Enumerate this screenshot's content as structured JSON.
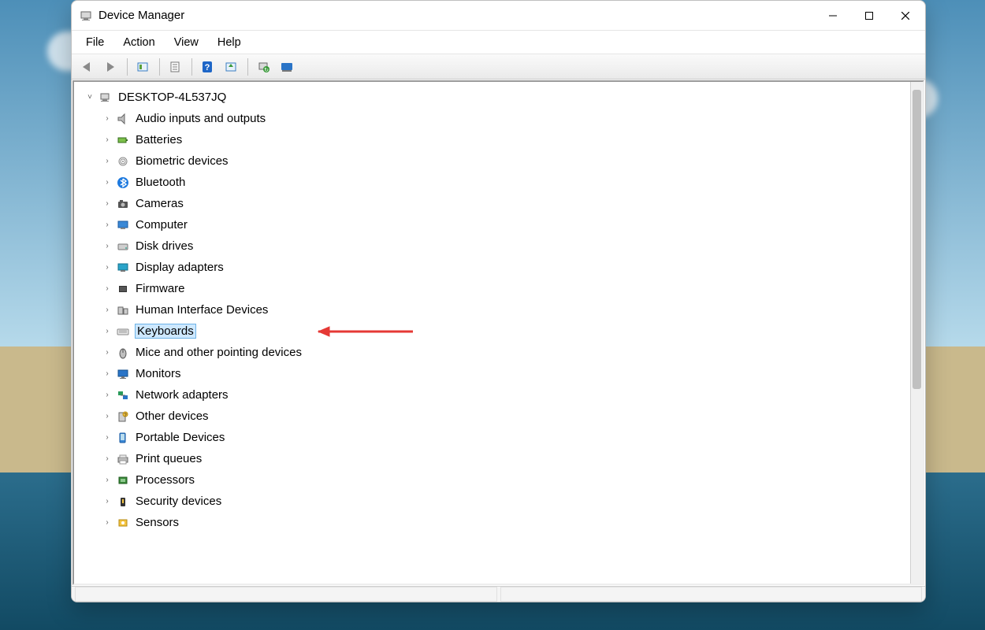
{
  "window": {
    "title": "Device Manager"
  },
  "menubar": {
    "items": [
      "File",
      "Action",
      "View",
      "Help"
    ]
  },
  "toolbar": {
    "buttons": [
      {
        "name": "back-icon"
      },
      {
        "name": "forward-icon"
      },
      {
        "sep": true
      },
      {
        "name": "show-hidden-icon"
      },
      {
        "sep": true
      },
      {
        "name": "properties-icon"
      },
      {
        "sep": true
      },
      {
        "name": "help-icon"
      },
      {
        "name": "update-driver-icon"
      },
      {
        "sep": true
      },
      {
        "name": "uninstall-icon"
      },
      {
        "name": "scan-hardware-icon"
      }
    ]
  },
  "tree": {
    "root": {
      "label": "DESKTOP-4L537JQ",
      "expanded": true
    },
    "categories": [
      {
        "label": "Audio inputs and outputs",
        "icon": "speaker-icon"
      },
      {
        "label": "Batteries",
        "icon": "battery-icon"
      },
      {
        "label": "Biometric devices",
        "icon": "fingerprint-icon"
      },
      {
        "label": "Bluetooth",
        "icon": "bluetooth-icon"
      },
      {
        "label": "Cameras",
        "icon": "camera-icon"
      },
      {
        "label": "Computer",
        "icon": "computer-icon"
      },
      {
        "label": "Disk drives",
        "icon": "disk-icon"
      },
      {
        "label": "Display adapters",
        "icon": "display-adapter-icon"
      },
      {
        "label": "Firmware",
        "icon": "firmware-icon"
      },
      {
        "label": "Human Interface Devices",
        "icon": "hid-icon"
      },
      {
        "label": "Keyboards",
        "icon": "keyboard-icon",
        "selected": true,
        "annotated": true
      },
      {
        "label": "Mice and other pointing devices",
        "icon": "mouse-icon"
      },
      {
        "label": "Monitors",
        "icon": "monitor-icon"
      },
      {
        "label": "Network adapters",
        "icon": "network-icon"
      },
      {
        "label": "Other devices",
        "icon": "other-devices-icon"
      },
      {
        "label": "Portable Devices",
        "icon": "portable-icon"
      },
      {
        "label": "Print queues",
        "icon": "printer-icon"
      },
      {
        "label": "Processors",
        "icon": "processor-icon"
      },
      {
        "label": "Security devices",
        "icon": "security-icon"
      },
      {
        "label": "Sensors",
        "icon": "sensor-icon"
      }
    ]
  },
  "annotation": {
    "arrow_color": "#e53935"
  }
}
